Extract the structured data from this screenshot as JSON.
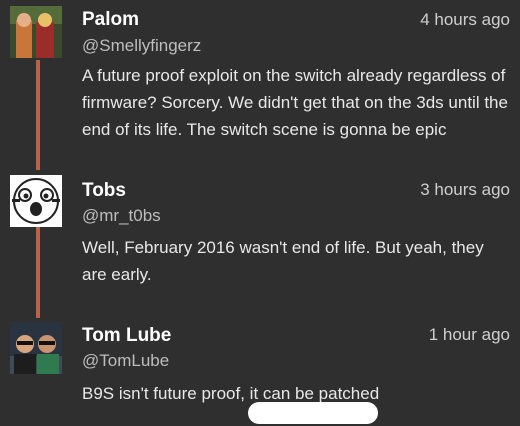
{
  "posts": [
    {
      "name": "Palom",
      "handle": "@Smellyfingerz",
      "time": "4 hours ago",
      "body": "A future proof exploit on the switch already regardless of firmware? Sorcery. We didn't get that on the 3ds until the end of its life. The switch scene is gonna be epic"
    },
    {
      "name": "Tobs",
      "handle": "@mr_t0bs",
      "time": "3 hours ago",
      "body": "Well, February 2016 wasn't end of life. But yeah, they are early."
    },
    {
      "name": "Tom Lube",
      "handle": "@TomLube",
      "time": "1 hour ago",
      "body": "B9S isn't future proof, it can be patched"
    }
  ],
  "colors": {
    "background": "#2f2f2f",
    "thread_line": "#b9644a",
    "text": "#e8e8e8",
    "muted": "#bdbdbd"
  }
}
